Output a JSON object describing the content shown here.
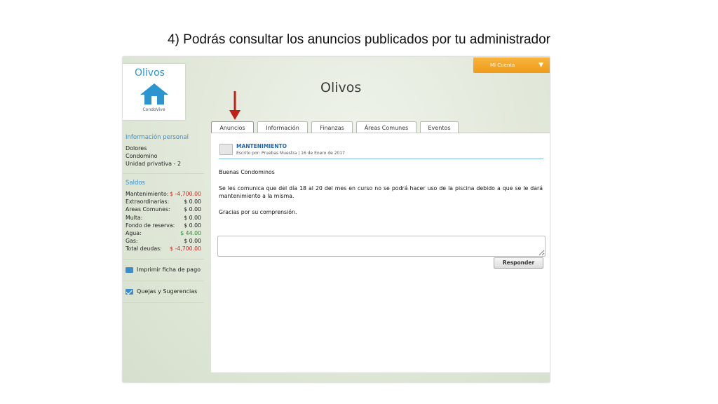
{
  "slide_title": "4) Podrás consultar los anuncios publicados por tu administrador",
  "header": {
    "account_button": "Mi Cuenta",
    "app_title": "Olivos"
  },
  "logo": {
    "name": "Olivos",
    "sub": "CondoVive"
  },
  "sidebar": {
    "personal_title": "Información personal",
    "personal_lines": [
      "Dolores",
      "Condomino",
      "Unidad privativa - 2"
    ],
    "balances_title": "Saldos",
    "balances": [
      {
        "label": "Mantenimiento:",
        "value": "$ -4,700.00",
        "status": "negative"
      },
      {
        "label": "Extraordinarias:",
        "value": "$ 0.00",
        "status": "neutral"
      },
      {
        "label": "Areas Comunes:",
        "value": "$ 0.00",
        "status": "neutral"
      },
      {
        "label": "Multa:",
        "value": "$ 0.00",
        "status": "neutral"
      },
      {
        "label": "Fondo de reserva:",
        "value": "$ 0.00",
        "status": "neutral"
      },
      {
        "label": "Agua:",
        "value": "$ 44.00",
        "status": "positive"
      },
      {
        "label": "Gas:",
        "value": "$ 0.00",
        "status": "neutral"
      },
      {
        "label": "Total deudas:",
        "value": "$ -4,700.00",
        "status": "negative"
      }
    ],
    "print_link": "Imprimir ficha de pago",
    "complaints_link": "Quejas y Sugerencias"
  },
  "tabs": [
    "Anuncios",
    "Información",
    "Finanzas",
    "Áreas Comunes",
    "Eventos"
  ],
  "active_tab": "Anuncios",
  "post": {
    "title": "MANTENIMIENTO",
    "meta": "Escrito por: Pruebas  Muestra | 16 de Enero de 2017",
    "greeting": "Buenas Condominos",
    "body": "Se les comunica que del día 18 al 20 del mes en curso no se podrá hacer uso de la piscina debido a que se le dará mantenimiento a la misma.",
    "closing": "Gracias por su comprensión."
  },
  "reply": {
    "placeholder": "",
    "button": "Responder"
  },
  "colors": {
    "accent_orange": "#f0a025",
    "link_blue": "#2a95cf",
    "negative_red": "#d9251d",
    "positive_green": "#2d8a2d",
    "arrow_red": "#c0201a"
  }
}
